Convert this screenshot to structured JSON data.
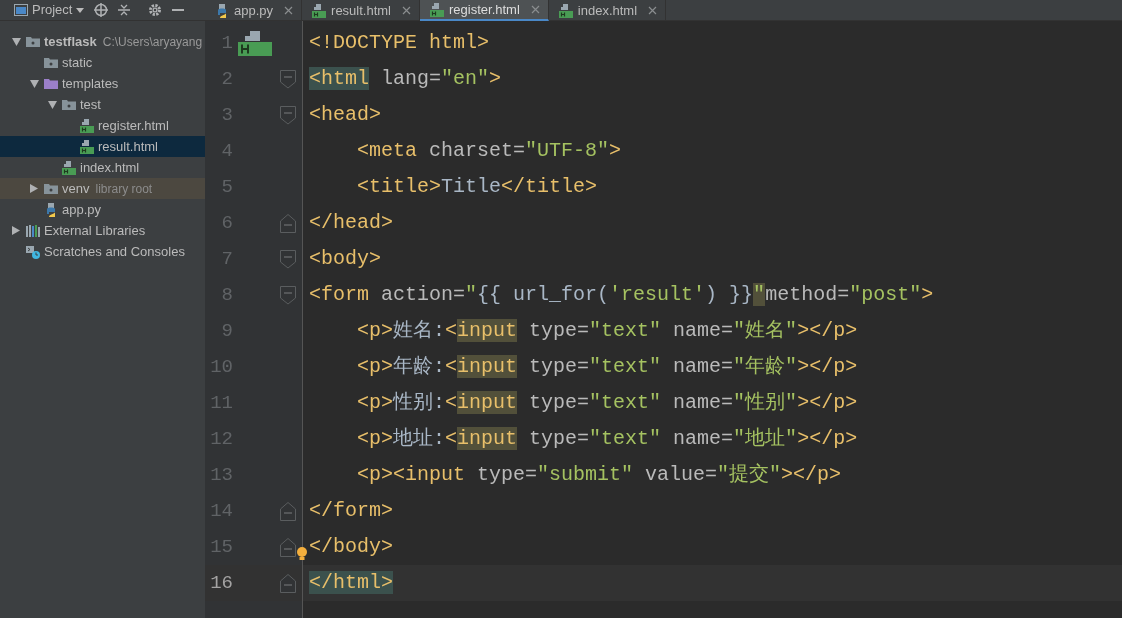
{
  "project_header": {
    "label": "Project"
  },
  "tree": [
    {
      "label": "testflask",
      "hint": "C:\\Users\\aryayang",
      "kind": "folder",
      "expanded": true,
      "selected": false,
      "highlighted": false,
      "children": [
        {
          "label": "static",
          "kind": "folder",
          "selected": false,
          "highlighted": false
        },
        {
          "label": "templates",
          "kind": "folder-purple",
          "expanded": true,
          "selected": false,
          "highlighted": false,
          "children": [
            {
              "label": "test",
              "kind": "folder",
              "expanded": true,
              "selected": false,
              "highlighted": false,
              "children": [
                {
                  "label": "register.html",
                  "kind": "html",
                  "selected": false,
                  "highlighted": false
                },
                {
                  "label": "result.html",
                  "kind": "html",
                  "selected": true,
                  "highlighted": false
                }
              ]
            },
            {
              "label": "index.html",
              "kind": "html",
              "selected": false,
              "highlighted": false
            }
          ]
        },
        {
          "label": "venv",
          "hint": "library root",
          "kind": "folder",
          "expanded": false,
          "selected": false,
          "highlighted": true
        },
        {
          "label": "app.py",
          "kind": "py",
          "selected": false,
          "highlighted": false
        }
      ]
    },
    {
      "label": "External Libraries",
      "kind": "libraries",
      "expanded": false,
      "selected": false,
      "highlighted": false
    },
    {
      "label": "Scratches and Consoles",
      "kind": "scratches",
      "selected": false,
      "highlighted": false
    }
  ],
  "tabs": [
    {
      "label": "app.py",
      "kind": "py",
      "selected": false
    },
    {
      "label": "result.html",
      "kind": "html",
      "selected": false
    },
    {
      "label": "register.html",
      "kind": "html",
      "selected": true
    },
    {
      "label": "index.html",
      "kind": "html",
      "selected": false
    }
  ],
  "lines": [
    {
      "number": "1",
      "fold_start": false,
      "fold_end": false,
      "current": false,
      "bulb": false,
      "tokens": [
        {
          "text": "<!DOCTYPE html>",
          "kind": "tag"
        }
      ]
    },
    {
      "number": "2",
      "fold_start": true,
      "fold_end": false,
      "current": false,
      "bulb": false,
      "tokens": [
        {
          "text": "<html",
          "kind": "tag-match"
        },
        {
          "text": " lang=",
          "kind": "attr"
        },
        {
          "text": "\"en\"",
          "kind": "str"
        },
        {
          "text": ">",
          "kind": "tag"
        }
      ]
    },
    {
      "number": "3",
      "fold_start": true,
      "fold_end": false,
      "current": false,
      "bulb": false,
      "tokens": [
        {
          "text": "<head>",
          "kind": "tag"
        }
      ],
      "children": [
        {
          "number": "4",
          "fold_start": false,
          "fold_end": false,
          "current": false,
          "bulb": false,
          "tokens": [
            {
              "text": "<meta",
              "kind": "tag"
            },
            {
              "text": " charset=",
              "kind": "attr"
            },
            {
              "text": "\"UTF-8\"",
              "kind": "str"
            },
            {
              "text": ">",
              "kind": "tag"
            }
          ]
        },
        {
          "number": "5",
          "fold_start": false,
          "fold_end": false,
          "current": false,
          "bulb": false,
          "tokens": [
            {
              "text": "<title>",
              "kind": "tag"
            },
            {
              "text": "Title",
              "kind": "text"
            },
            {
              "text": "</title>",
              "kind": "tag"
            }
          ]
        }
      ]
    },
    {
      "number": "6",
      "fold_start": false,
      "fold_end": true,
      "current": false,
      "bulb": false,
      "tokens": [
        {
          "text": "</head>",
          "kind": "tag"
        }
      ]
    },
    {
      "number": "7",
      "fold_start": true,
      "fold_end": false,
      "current": false,
      "bulb": false,
      "tokens": [
        {
          "text": "<body>",
          "kind": "tag"
        }
      ]
    },
    {
      "number": "8",
      "fold_start": true,
      "fold_end": false,
      "current": false,
      "bulb": false,
      "tokens": [
        {
          "text": "<form",
          "kind": "tag"
        },
        {
          "text": " action=",
          "kind": "attr"
        },
        {
          "text": "\"",
          "kind": "str"
        },
        {
          "text": "{{ url_for(",
          "kind": "text"
        },
        {
          "text": "'result'",
          "kind": "str"
        },
        {
          "text": ") }}",
          "kind": "text"
        },
        {
          "text": "\"",
          "kind": "str-hl"
        },
        {
          "text": "method=",
          "kind": "attr"
        },
        {
          "text": "\"post\"",
          "kind": "str"
        },
        {
          "text": ">",
          "kind": "tag"
        }
      ],
      "children": [
        {
          "number": "9",
          "fold_start": false,
          "fold_end": false,
          "current": false,
          "bulb": false,
          "tokens": [
            {
              "text": "<p>",
              "kind": "tag"
            },
            {
              "text": "姓名:",
              "kind": "text"
            },
            {
              "text": "<",
              "kind": "tag"
            },
            {
              "text": "input",
              "kind": "tag-hl"
            },
            {
              "text": " type=",
              "kind": "attr"
            },
            {
              "text": "\"text\"",
              "kind": "str"
            },
            {
              "text": " name=",
              "kind": "attr"
            },
            {
              "text": "\"姓名\"",
              "kind": "str"
            },
            {
              "text": "></p>",
              "kind": "tag"
            }
          ]
        },
        {
          "number": "10",
          "fold_start": false,
          "fold_end": false,
          "current": false,
          "bulb": false,
          "tokens": [
            {
              "text": "<p>",
              "kind": "tag"
            },
            {
              "text": "年龄:",
              "kind": "text"
            },
            {
              "text": "<",
              "kind": "tag"
            },
            {
              "text": "input",
              "kind": "tag-hl"
            },
            {
              "text": " type=",
              "kind": "attr"
            },
            {
              "text": "\"text\"",
              "kind": "str"
            },
            {
              "text": " name=",
              "kind": "attr"
            },
            {
              "text": "\"年龄\"",
              "kind": "str"
            },
            {
              "text": "></p>",
              "kind": "tag"
            }
          ]
        },
        {
          "number": "11",
          "fold_start": false,
          "fold_end": false,
          "current": false,
          "bulb": false,
          "tokens": [
            {
              "text": "<p>",
              "kind": "tag"
            },
            {
              "text": "性别:",
              "kind": "text"
            },
            {
              "text": "<",
              "kind": "tag"
            },
            {
              "text": "input",
              "kind": "tag-hl"
            },
            {
              "text": " type=",
              "kind": "attr"
            },
            {
              "text": "\"text\"",
              "kind": "str"
            },
            {
              "text": " name=",
              "kind": "attr"
            },
            {
              "text": "\"性别\"",
              "kind": "str"
            },
            {
              "text": "></p>",
              "kind": "tag"
            }
          ]
        },
        {
          "number": "12",
          "fold_start": false,
          "fold_end": false,
          "current": false,
          "bulb": false,
          "tokens": [
            {
              "text": "<p>",
              "kind": "tag"
            },
            {
              "text": "地址:",
              "kind": "text"
            },
            {
              "text": "<",
              "kind": "tag"
            },
            {
              "text": "input",
              "kind": "tag-hl"
            },
            {
              "text": " type=",
              "kind": "attr"
            },
            {
              "text": "\"text\"",
              "kind": "str"
            },
            {
              "text": " name=",
              "kind": "attr"
            },
            {
              "text": "\"地址\"",
              "kind": "str"
            },
            {
              "text": "></p>",
              "kind": "tag"
            }
          ]
        },
        {
          "number": "13",
          "fold_start": false,
          "fold_end": false,
          "current": false,
          "bulb": false,
          "tokens": [
            {
              "text": "<p><input",
              "kind": "tag"
            },
            {
              "text": " type=",
              "kind": "attr"
            },
            {
              "text": "\"submit\"",
              "kind": "str"
            },
            {
              "text": " value=",
              "kind": "attr"
            },
            {
              "text": "\"提交\"",
              "kind": "str"
            },
            {
              "text": "></p>",
              "kind": "tag"
            }
          ]
        }
      ]
    },
    {
      "number": "14",
      "fold_start": false,
      "fold_end": true,
      "current": false,
      "bulb": false,
      "tokens": [
        {
          "text": "</form>",
          "kind": "tag"
        }
      ]
    },
    {
      "number": "15",
      "fold_start": false,
      "fold_end": true,
      "current": false,
      "bulb": true,
      "tokens": [
        {
          "text": "</body>",
          "kind": "tag"
        }
      ]
    },
    {
      "number": "16",
      "fold_start": false,
      "fold_end": true,
      "current": true,
      "bulb": false,
      "tokens": [
        {
          "text": "</html>",
          "kind": "tag-match"
        }
      ]
    }
  ]
}
